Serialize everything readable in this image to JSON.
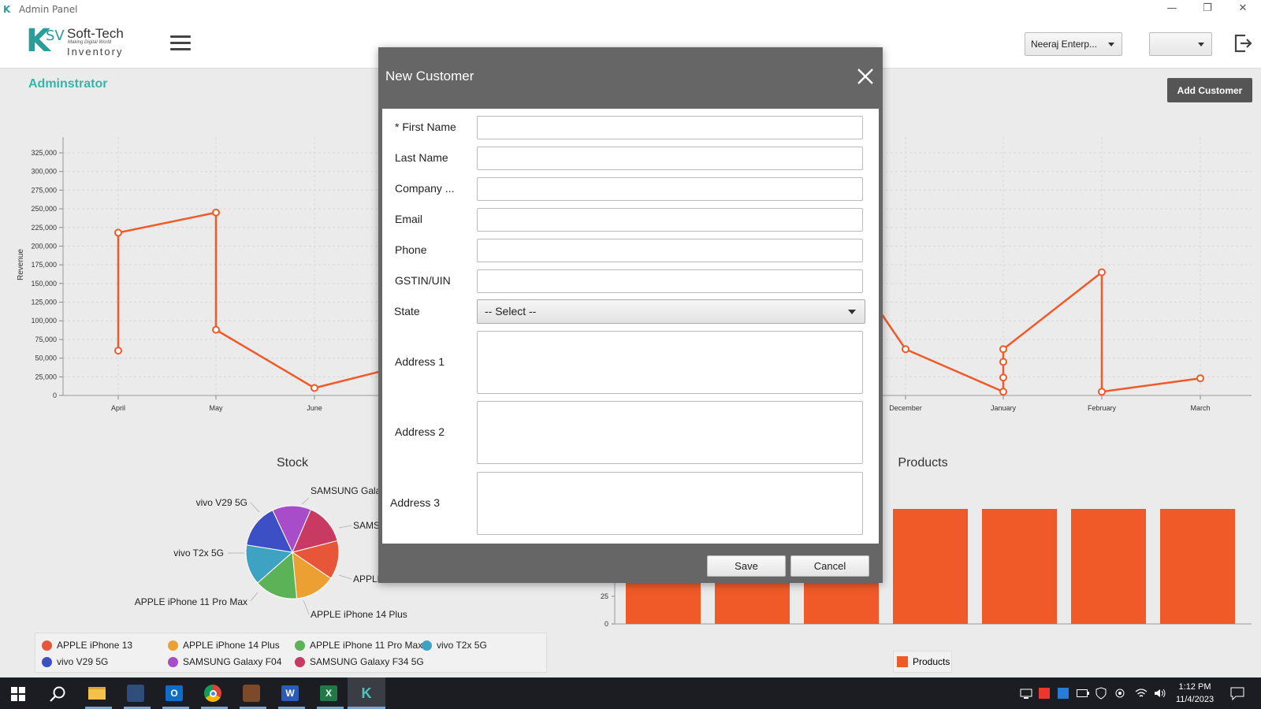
{
  "window": {
    "title": "Admin Panel",
    "minimize": "—",
    "maximize": "❐",
    "close": "✕"
  },
  "header": {
    "logo": {
      "mark": "K",
      "sv": "SV",
      "brand": "Soft-Tech",
      "tagline": "Making Digital World",
      "product": "Inventory"
    },
    "company_select": "Neeraj Enterp...",
    "second_select": ""
  },
  "page": {
    "role_label": "Adminstrator",
    "add_customer_label": "Add Customer"
  },
  "revenue_chart": {
    "ylabel": "Revenue",
    "y_ticks": [
      "325,000",
      "300,000",
      "275,000",
      "250,000",
      "225,000",
      "200,000",
      "175,000",
      "150,000",
      "125,000",
      "100,000",
      "75,000",
      "50,000",
      "25,000",
      "0"
    ],
    "x_ticks_left": [
      "April",
      "May",
      "June"
    ],
    "x_ticks_right": [
      "December",
      "January",
      "February",
      "March"
    ]
  },
  "stock_chart": {
    "title": "Stock",
    "labels": [
      "SAMSUNG Galax",
      "SAMS",
      "APPLE",
      "APPLE iPhone 14 Plus",
      "APPLE iPhone 11 Pro Max",
      "vivo T2x 5G",
      "vivo V29 5G"
    ],
    "legend": [
      {
        "name": "APPLE iPhone 13",
        "color": "#e8563a"
      },
      {
        "name": "APPLE iPhone 14 Plus",
        "color": "#eba031"
      },
      {
        "name": "APPLE iPhone 11 Pro Max",
        "color": "#5cb256"
      },
      {
        "name": "vivo T2x 5G",
        "color": "#3ea3c2"
      },
      {
        "name": "vivo V29 5G",
        "color": "#3c4fc4"
      },
      {
        "name": "SAMSUNG Galaxy F04",
        "color": "#a84cc9"
      },
      {
        "name": "SAMSUNG Galaxy F34 5G",
        "color": "#c93a63"
      }
    ]
  },
  "products_chart": {
    "title": "Products",
    "y_ticks": [
      "25",
      "0"
    ],
    "legend": "Products",
    "color": "#f05a28"
  },
  "chart_data": [
    {
      "type": "line",
      "title": "",
      "xlabel": "",
      "ylabel": "Revenue",
      "ylim": [
        0,
        325000
      ],
      "grid": true,
      "series": [
        {
          "points": [
            {
              "x": "April",
              "y": 60000
            },
            {
              "x": "April",
              "y": 218000
            },
            {
              "x": "May",
              "y": 245000
            },
            {
              "x": "May",
              "y": 88000
            },
            {
              "x": "June",
              "y": 10000
            },
            {
              "x": "December",
              "y": 62000
            },
            {
              "x": "January",
              "y": 5000
            },
            {
              "x": "January",
              "y": 24000
            },
            {
              "x": "January",
              "y": 45000
            },
            {
              "x": "January",
              "y": 62000
            },
            {
              "x": "February",
              "y": 165000
            },
            {
              "x": "February",
              "y": 5000
            },
            {
              "x": "March",
              "y": 23000
            }
          ]
        }
      ]
    },
    {
      "type": "pie",
      "title": "Stock",
      "categories": [
        "APPLE iPhone 13",
        "APPLE iPhone 14 Plus",
        "APPLE iPhone 11 Pro Max",
        "vivo T2x 5G",
        "vivo V29 5G",
        "SAMSUNG Galaxy F04",
        "SAMSUNG Galaxy F34 5G"
      ],
      "values": [
        13.5,
        14,
        15,
        14,
        15.5,
        13.5,
        14.5
      ],
      "legend": "bottom"
    },
    {
      "type": "bar",
      "title": "Products",
      "values": [
        100,
        100,
        100,
        100,
        100,
        100,
        100
      ],
      "legend": "bottom"
    }
  ],
  "modal": {
    "title": "New Customer",
    "fields": {
      "first_name": {
        "label": "* First Name",
        "value": ""
      },
      "last_name": {
        "label": "Last Name",
        "value": ""
      },
      "company": {
        "label": "Company ...",
        "value": ""
      },
      "email": {
        "label": "Email",
        "value": ""
      },
      "phone": {
        "label": "Phone",
        "value": ""
      },
      "gstin": {
        "label": "GSTIN/UIN",
        "value": ""
      },
      "state": {
        "label": "State",
        "value": "-- Select --"
      },
      "address1": {
        "label": "Address 1",
        "value": ""
      },
      "address2": {
        "label": "Address 2",
        "value": ""
      },
      "address3": {
        "label": "Address 3",
        "value": ""
      }
    },
    "save_label": "Save",
    "cancel_label": "Cancel"
  },
  "taskbar": {
    "apps": [
      "start",
      "search",
      "file-explorer",
      "sql-tool",
      "outlook",
      "chrome",
      "game",
      "word",
      "excel",
      "ksv-app"
    ],
    "time": "1:12 PM",
    "date": "11/4/2023"
  }
}
